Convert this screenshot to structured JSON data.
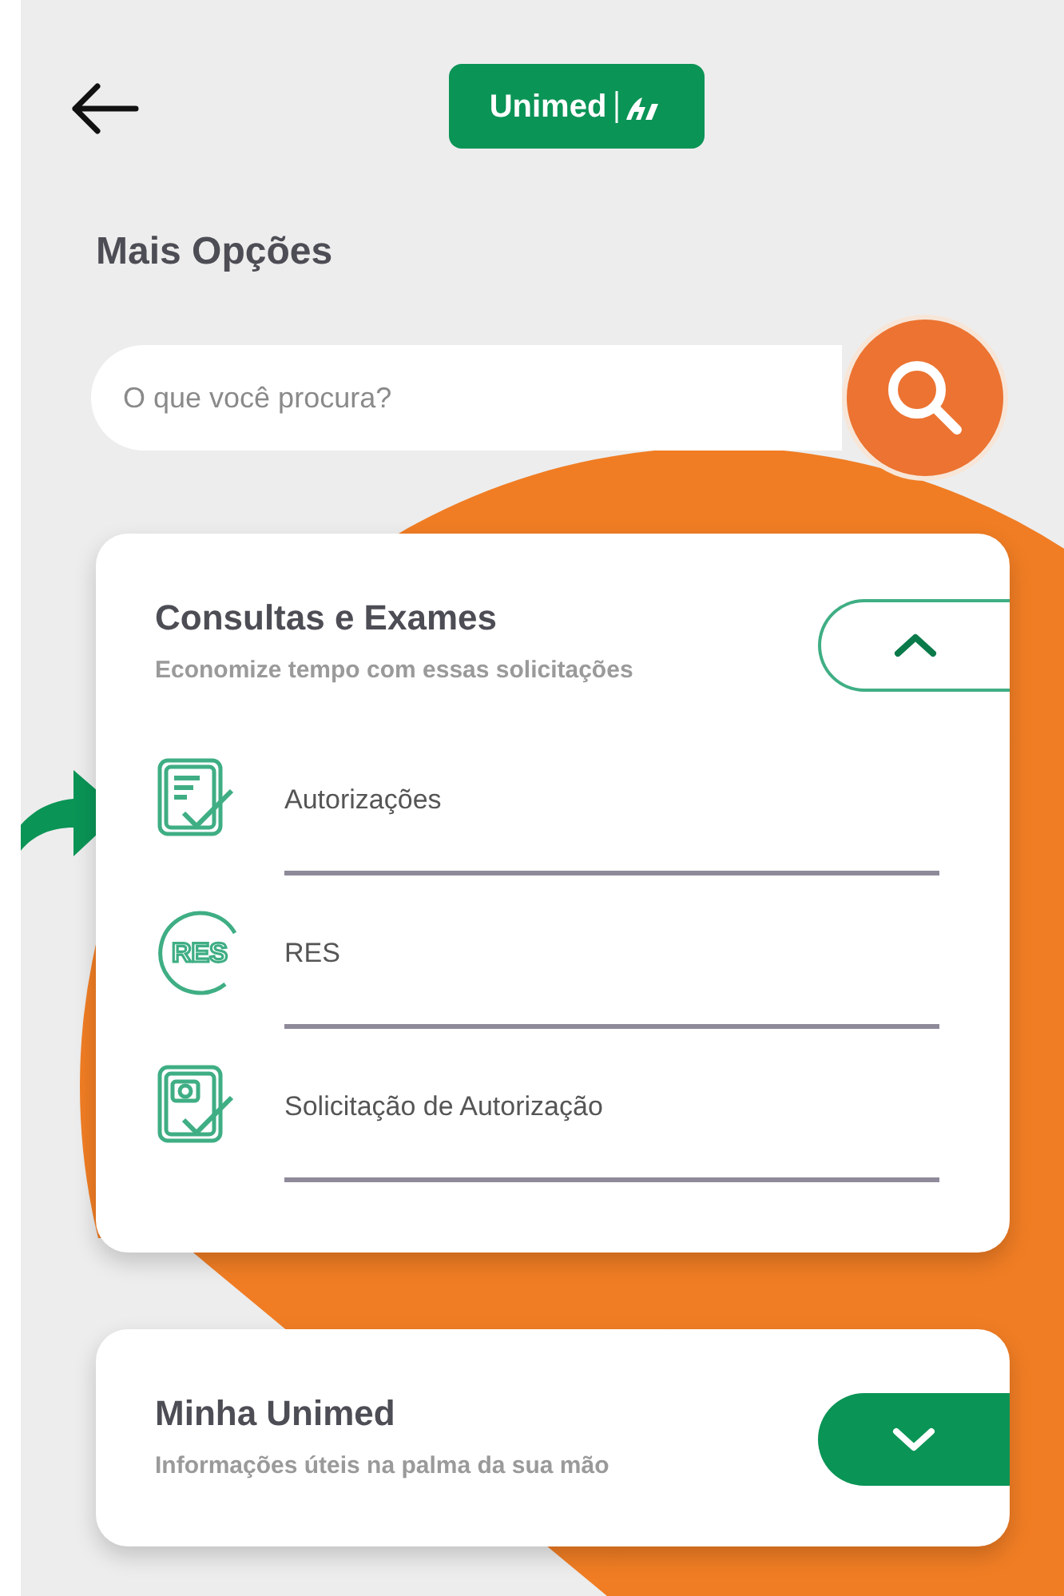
{
  "header": {
    "logo": "Unimed"
  },
  "title": "Mais Opções",
  "search": {
    "placeholder": "O que você procura?"
  },
  "sections": [
    {
      "title": "Consultas e Exames",
      "subtitle": "Economize tempo com essas solicitações",
      "expanded": true,
      "items": [
        {
          "kind": "document-check",
          "label": "Autorizações"
        },
        {
          "kind": "res-badge",
          "icon_label": "RES",
          "label": "RES"
        },
        {
          "kind": "photo-check",
          "label": "Solicitação de Autorização"
        }
      ]
    },
    {
      "title": "Minha Unimed",
      "subtitle": "Informações úteis na palma da sua mão",
      "expanded": false
    }
  ]
}
